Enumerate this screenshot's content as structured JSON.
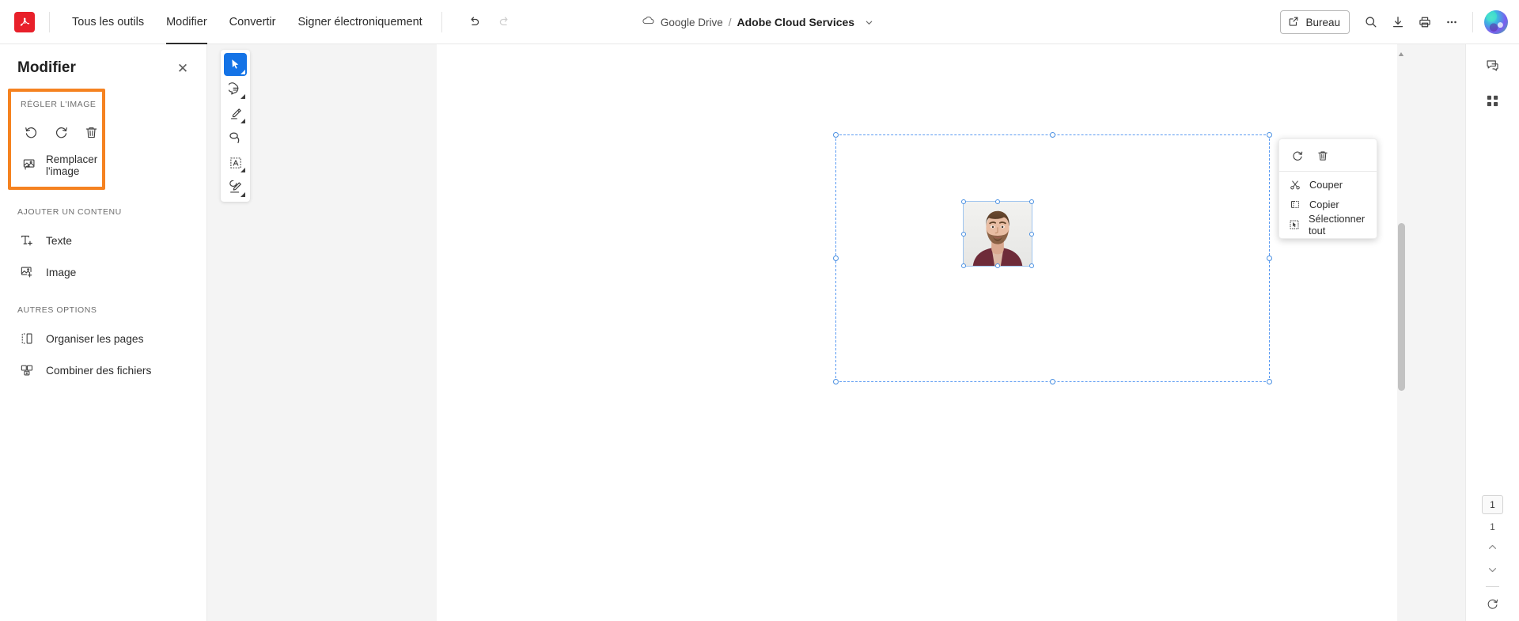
{
  "app": {
    "logo_icon": "adobe-acrobat-logo",
    "brand_color": "#e8202a"
  },
  "topbar": {
    "nav_items": [
      {
        "label": "Tous les outils",
        "active": false
      },
      {
        "label": "Modifier",
        "active": true
      },
      {
        "label": "Convertir",
        "active": false
      },
      {
        "label": "Signer électroniquement",
        "active": false
      }
    ],
    "undo_icon": "undo-icon",
    "redo_icon": "redo-icon",
    "redo_disabled": true,
    "breadcrumb": {
      "cloud_icon": "cloud-icon",
      "storage": "Google Drive",
      "separator": "/",
      "file_name": "Adobe Cloud Services",
      "chevron_icon": "chevron-down-icon"
    },
    "right": {
      "desktop_label": "Bureau",
      "desktop_icon": "external-link-icon",
      "search_icon": "search-icon",
      "download_icon": "download-icon",
      "print_icon": "print-icon",
      "more_icon": "more-horizontal-icon",
      "avatar_icon": "user-avatar"
    }
  },
  "left_panel": {
    "title": "Modifier",
    "close_icon": "close-icon",
    "highlight_color": "#f58220",
    "adjust_section": {
      "label": "RÉGLER L'IMAGE",
      "buttons": [
        {
          "icon": "rotate-counterclockwise-icon",
          "name": "rotate-left-button"
        },
        {
          "icon": "rotate-clockwise-icon",
          "name": "rotate-right-button"
        },
        {
          "icon": "trash-icon",
          "name": "delete-image-button"
        }
      ],
      "replace_label": "Remplacer l'image",
      "replace_icon": "replace-image-icon"
    },
    "add_content": {
      "label": "AJOUTER UN CONTENU",
      "items": [
        {
          "label": "Texte",
          "icon": "add-text-icon"
        },
        {
          "label": "Image",
          "icon": "add-image-icon"
        }
      ]
    },
    "other_options": {
      "label": "AUTRES OPTIONS",
      "items": [
        {
          "label": "Organiser les pages",
          "icon": "organize-pages-icon"
        },
        {
          "label": "Combiner des fichiers",
          "icon": "combine-files-icon"
        }
      ]
    }
  },
  "tool_strip": {
    "tools": [
      {
        "name": "select-tool",
        "icon": "cursor-arrow-icon",
        "selected": true
      },
      {
        "name": "comment-tool",
        "icon": "comment-bubble-icon",
        "selected": false
      },
      {
        "name": "highlight-tool",
        "icon": "highlighter-pen-icon",
        "selected": false
      },
      {
        "name": "draw-tool",
        "icon": "lasso-loop-icon",
        "selected": false
      },
      {
        "name": "edit-text-tool",
        "icon": "text-box-icon",
        "selected": false
      },
      {
        "name": "sign-tool",
        "icon": "signature-pen-icon",
        "selected": false
      }
    ],
    "selected_color": "#1473e6"
  },
  "context_menu": {
    "top_buttons": [
      {
        "icon": "rotate-clockwise-icon",
        "name": "rotate-button"
      },
      {
        "icon": "trash-icon",
        "name": "delete-button"
      }
    ],
    "items": [
      {
        "label": "Couper",
        "icon": "scissors-icon"
      },
      {
        "label": "Copier",
        "icon": "copy-icon"
      },
      {
        "label": "Sélectionner tout",
        "icon": "select-all-icon"
      }
    ]
  },
  "canvas": {
    "selection_color": "#5b9bf2",
    "image_alt": "portrait-photo"
  },
  "right_rail": {
    "buttons": [
      {
        "name": "comments-panel-button",
        "icon": "comment-check-icon"
      },
      {
        "name": "all-tools-grid-button",
        "icon": "grid-apps-icon"
      }
    ],
    "page_nav": {
      "current_page": "1",
      "total_pages": "1",
      "prev_icon": "chevron-up-icon",
      "next_icon": "chevron-down-icon",
      "rotate_icon": "rotate-view-icon"
    }
  }
}
